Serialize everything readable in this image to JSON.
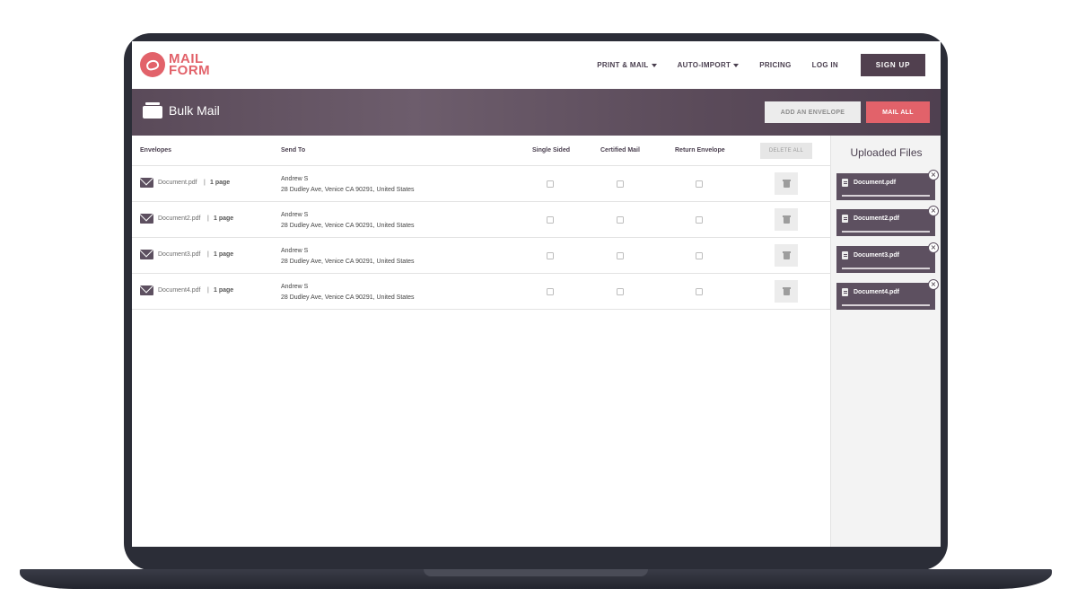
{
  "brand": {
    "name_line1": "MAIL",
    "name_line2": "FORM",
    "accent": "#e2626a",
    "primary": "#51404f"
  },
  "nav": {
    "items": [
      {
        "label": "PRINT & MAIL",
        "dropdown": true
      },
      {
        "label": "AUTO-IMPORT",
        "dropdown": true
      },
      {
        "label": "PRICING",
        "dropdown": false
      },
      {
        "label": "LOG IN",
        "dropdown": false
      }
    ],
    "signup_label": "SIGN UP"
  },
  "header": {
    "title": "Bulk Mail",
    "icon": "folder-icon",
    "add_envelope_label": "ADD AN ENVELOPE",
    "mail_all_label": "MAIL ALL"
  },
  "table": {
    "columns": {
      "envelopes": "Envelopes",
      "send_to": "Send To",
      "single_sided": "Single Sided",
      "certified_mail": "Certified Mail",
      "return_envelope": "Return Envelope"
    },
    "delete_all_label": "DELETE ALL",
    "rows": [
      {
        "file": "Document.pdf",
        "sep": "|",
        "pages": "1 page",
        "name": "Andrew S",
        "address": "28 Dudley Ave, Venice CA 90291, United States",
        "single_sided": false,
        "certified_mail": false,
        "return_envelope": false
      },
      {
        "file": "Document2.pdf",
        "sep": "|",
        "pages": "1 page",
        "name": "Andrew S",
        "address": "28 Dudley Ave, Venice CA 90291, United States",
        "single_sided": false,
        "certified_mail": false,
        "return_envelope": false
      },
      {
        "file": "Document3.pdf",
        "sep": "|",
        "pages": "1 page",
        "name": "Andrew S",
        "address": "28 Dudley Ave, Venice CA 90291, United States",
        "single_sided": false,
        "certified_mail": false,
        "return_envelope": false
      },
      {
        "file": "Document4.pdf",
        "sep": "|",
        "pages": "1 page",
        "name": "Andrew S",
        "address": "28 Dudley Ave, Venice CA 90291, United States",
        "single_sided": false,
        "certified_mail": false,
        "return_envelope": false
      }
    ]
  },
  "sidebar": {
    "title": "Uploaded Files",
    "files": [
      {
        "name": "Document.pdf",
        "remove": "×"
      },
      {
        "name": "Document2.pdf",
        "remove": "×"
      },
      {
        "name": "Document3.pdf",
        "remove": "×"
      },
      {
        "name": "Document4.pdf",
        "remove": "×"
      }
    ]
  }
}
